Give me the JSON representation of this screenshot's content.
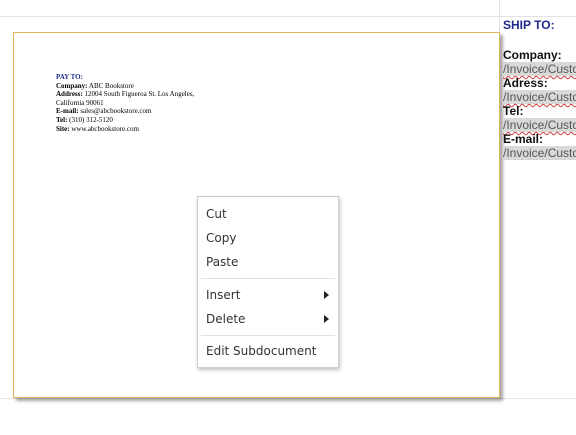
{
  "top_partial_text": "",
  "pay_to": {
    "heading": "PAY TO:",
    "company_label": "Company:",
    "company_value": "ABC Bookstore",
    "address_label": "Address:",
    "address_value": "12004 South Figueroa St. Los Angeles,",
    "address_line2": "California 90061",
    "email_label": "E-mail:",
    "email_value": "sales@abcbookstore.com",
    "tel_label": "Tel:",
    "tel_value": "(310) 312-5120",
    "site_label": "Site:",
    "site_value": "www.abcbookstore.com"
  },
  "ship_to": {
    "title": "SHIP TO:",
    "company_label": "Company:",
    "company_field": "/Invoice/Custo",
    "address_label": "Adress:",
    "address_field": "/Invoice/Custo",
    "tel_label": "Tel:",
    "tel_field": "/Invoice/Custo",
    "email_label": "E-mail:",
    "email_field": "/Invoice/Custo"
  },
  "context_menu": {
    "cut": "Cut",
    "copy": "Copy",
    "paste": "Paste",
    "insert": "Insert",
    "delete": "Delete",
    "edit_subdocument": "Edit Subdocument"
  }
}
